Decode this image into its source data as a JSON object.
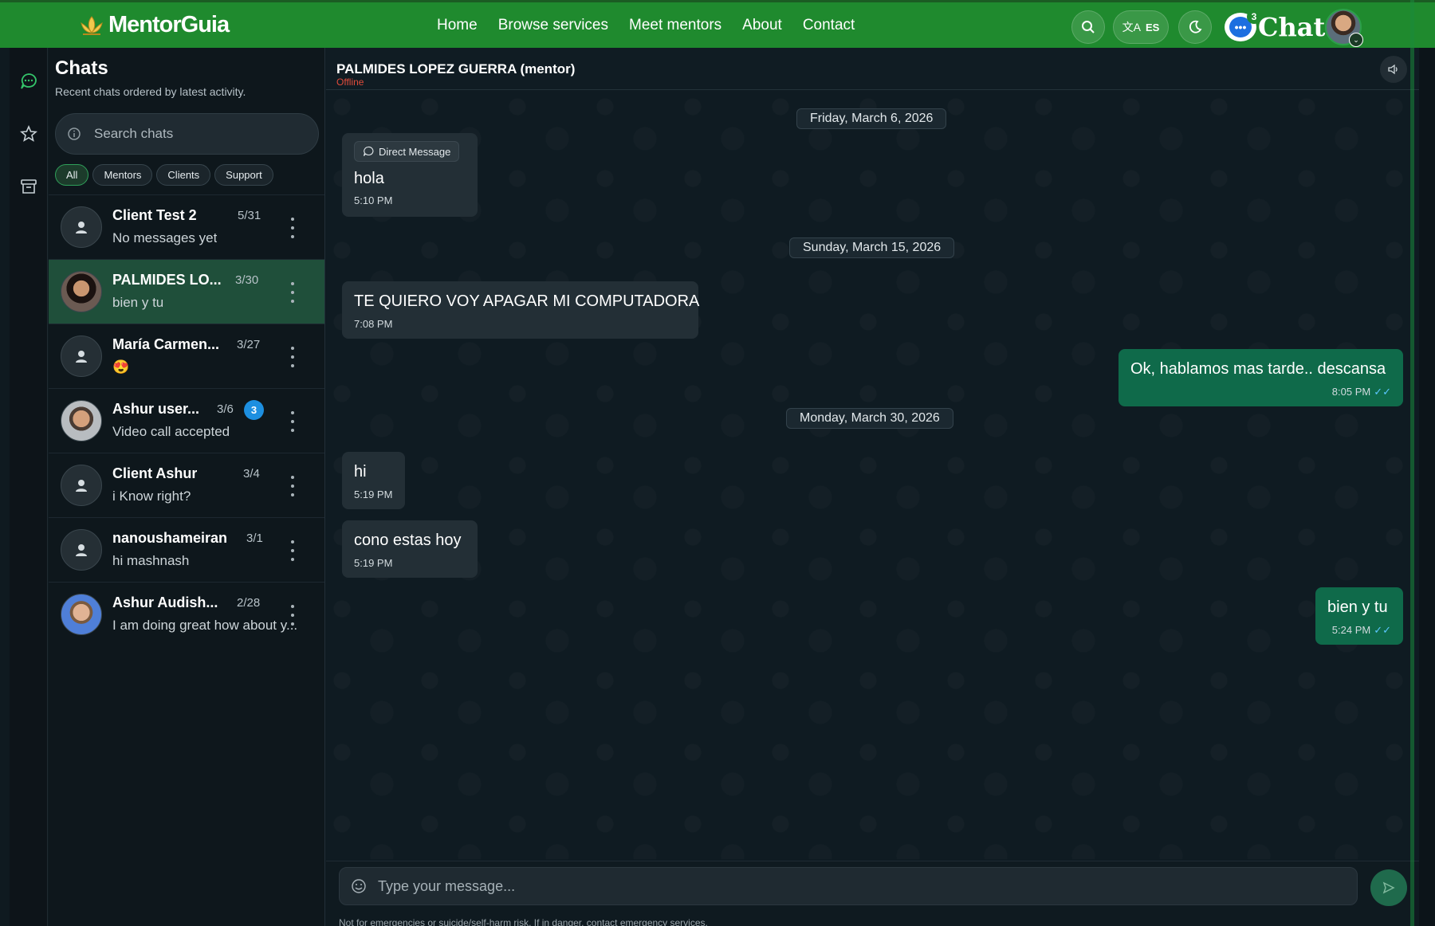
{
  "brand": {
    "name": "MentorGuia"
  },
  "nav": {
    "items": [
      "Home",
      "Browse services",
      "Meet mentors",
      "About",
      "Contact"
    ]
  },
  "topbar": {
    "lang_label": "ES",
    "chat_word": "Chat",
    "chat_badge": "3"
  },
  "sidebar": {
    "title": "Chats",
    "subtitle": "Recent chats ordered by latest activity.",
    "search_placeholder": "Search chats",
    "filters": [
      "All",
      "Mentors",
      "Clients",
      "Support"
    ],
    "active_filter": "All",
    "chats": [
      {
        "name": "Client Test 2",
        "date": "5/31",
        "preview": "No messages yet",
        "avatar": "default",
        "selected": false,
        "badge": ""
      },
      {
        "name": "PALMIDES LO...",
        "date": "3/30",
        "preview": "bien y tu",
        "avatar": "photo-woman",
        "selected": true,
        "badge": ""
      },
      {
        "name": "María Carmen...",
        "date": "3/27",
        "preview": "😍",
        "avatar": "default",
        "selected": false,
        "badge": ""
      },
      {
        "name": "Ashur user...",
        "date": "3/6",
        "preview": "Video call accepted",
        "avatar": "photo-man",
        "selected": false,
        "badge": "3"
      },
      {
        "name": "Client Ashur",
        "date": "3/4",
        "preview": "i Know right?",
        "avatar": "default",
        "selected": false,
        "badge": ""
      },
      {
        "name": "nanoushameiran",
        "date": "3/1",
        "preview": "hi mashnash",
        "avatar": "default",
        "selected": false,
        "badge": ""
      },
      {
        "name": "Ashur Audish...",
        "date": "2/28",
        "preview": "I am doing great how about y...",
        "avatar": "photo-man-blue",
        "selected": false,
        "badge": ""
      }
    ]
  },
  "conversation": {
    "contact_name": "PALMIDES LOPEZ GUERRA (mentor)",
    "status": "Offline",
    "date_separators": [
      "Friday, March 6, 2026",
      "Sunday, March 15, 2026",
      "Monday, March 30, 2026"
    ],
    "messages": [
      {
        "direction": "in",
        "tag": "Direct Message",
        "text": "hola",
        "time": "5:10 PM"
      },
      {
        "direction": "in",
        "tag": "",
        "text": "TE QUIERO VOY APAGAR MI COMPUTADORA",
        "time": "7:08 PM"
      },
      {
        "direction": "out",
        "tag": "",
        "text": "Ok, hablamos mas tarde.. descansa",
        "time": "8:05 PM",
        "read": true
      },
      {
        "direction": "in",
        "tag": "",
        "text": "hi",
        "time": "5:19 PM"
      },
      {
        "direction": "in",
        "tag": "",
        "text": "cono estas hoy",
        "time": "5:19 PM"
      },
      {
        "direction": "out",
        "tag": "",
        "text": "bien y tu",
        "time": "5:24 PM",
        "read": true
      }
    ]
  },
  "composer": {
    "placeholder": "Type your message...",
    "disclaimer": "Not for emergencies or suicide/self-harm risk. If in danger, contact emergency services."
  },
  "colors": {
    "brand_green": "#1f8a2e",
    "outgoing_bubble": "#0f6a4a",
    "incoming_bubble": "#232f36",
    "offline": "#e04b3a",
    "unread_badge": "#1d8fe0"
  }
}
